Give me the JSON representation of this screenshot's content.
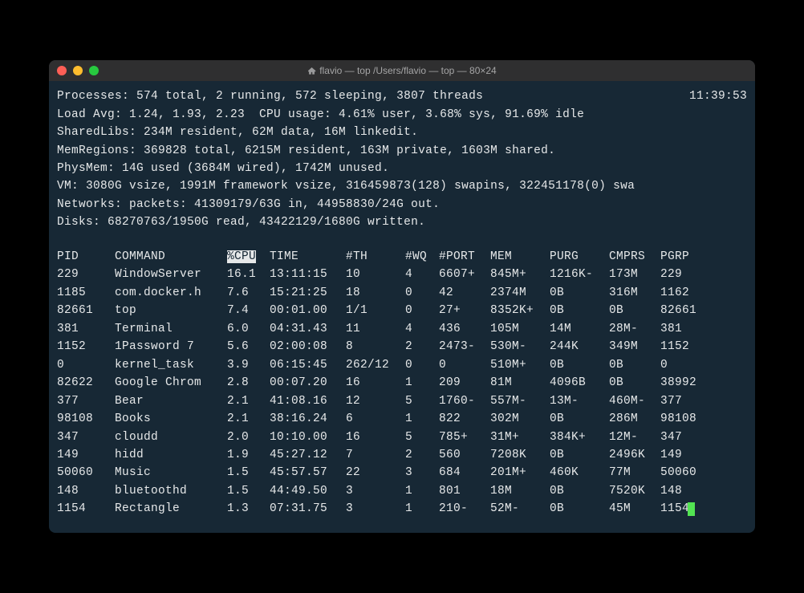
{
  "window": {
    "title": "flavio — top /Users/flavio — top — 80×24"
  },
  "summary": {
    "processes_line": "Processes: 574 total, 2 running, 572 sleeping, 3807 threads",
    "time": "11:39:53",
    "load_line": "Load Avg: 1.24, 1.93, 2.23  CPU usage: 4.61% user, 3.68% sys, 91.69% idle",
    "sharedlibs_line": "SharedLibs: 234M resident, 62M data, 16M linkedit.",
    "memregions_line": "MemRegions: 369828 total, 6215M resident, 163M private, 1603M shared.",
    "physmem_line": "PhysMem: 14G used (3684M wired), 1742M unused.",
    "vm_line": "VM: 3080G vsize, 1991M framework vsize, 316459873(128) swapins, 322451178(0) swa",
    "networks_line": "Networks: packets: 41309179/63G in, 44958830/24G out.",
    "disks_line": "Disks: 68270763/1950G read, 43422129/1680G written."
  },
  "headers": {
    "pid": "PID",
    "command": "COMMAND",
    "cpu": "%CPU",
    "time": "TIME",
    "th": "#TH",
    "wq": "#WQ",
    "port": "#PORT",
    "mem": "MEM",
    "purg": "PURG",
    "cmprs": "CMPRS",
    "pgrp": "PGRP"
  },
  "rows": [
    {
      "pid": "229",
      "command": "WindowServer",
      "cpu": "16.1",
      "time": "13:11:15",
      "th": "10",
      "wq": "4",
      "port": "6607+",
      "mem": "845M+",
      "purg": "1216K-",
      "cmprs": "173M",
      "pgrp": "229"
    },
    {
      "pid": "1185",
      "command": "com.docker.h",
      "cpu": "7.6",
      "time": "15:21:25",
      "th": "18",
      "wq": "0",
      "port": "42",
      "mem": "2374M",
      "purg": "0B",
      "cmprs": "316M",
      "pgrp": "1162"
    },
    {
      "pid": "82661",
      "command": "top",
      "cpu": "7.4",
      "time": "00:01.00",
      "th": "1/1",
      "wq": "0",
      "port": "27+",
      "mem": "8352K+",
      "purg": "0B",
      "cmprs": "0B",
      "pgrp": "82661"
    },
    {
      "pid": "381",
      "command": "Terminal",
      "cpu": "6.0",
      "time": "04:31.43",
      "th": "11",
      "wq": "4",
      "port": "436",
      "mem": "105M",
      "purg": "14M",
      "cmprs": "28M-",
      "pgrp": "381"
    },
    {
      "pid": "1152",
      "command": "1Password 7",
      "cpu": "5.6",
      "time": "02:00:08",
      "th": "8",
      "wq": "2",
      "port": "2473-",
      "mem": "530M-",
      "purg": "244K",
      "cmprs": "349M",
      "pgrp": "1152"
    },
    {
      "pid": "0",
      "command": "kernel_task",
      "cpu": "3.9",
      "time": "06:15:45",
      "th": "262/12",
      "wq": "0",
      "port": "0",
      "mem": "510M+",
      "purg": "0B",
      "cmprs": "0B",
      "pgrp": "0"
    },
    {
      "pid": "82622",
      "command": "Google Chrom",
      "cpu": "2.8",
      "time": "00:07.20",
      "th": "16",
      "wq": "1",
      "port": "209",
      "mem": "81M",
      "purg": "4096B",
      "cmprs": "0B",
      "pgrp": "38992"
    },
    {
      "pid": "377",
      "command": "Bear",
      "cpu": "2.1",
      "time": "41:08.16",
      "th": "12",
      "wq": "5",
      "port": "1760-",
      "mem": "557M-",
      "purg": "13M-",
      "cmprs": "460M-",
      "pgrp": "377"
    },
    {
      "pid": "98108",
      "command": "Books",
      "cpu": "2.1",
      "time": "38:16.24",
      "th": "6",
      "wq": "1",
      "port": "822",
      "mem": "302M",
      "purg": "0B",
      "cmprs": "286M",
      "pgrp": "98108"
    },
    {
      "pid": "347",
      "command": "cloudd",
      "cpu": "2.0",
      "time": "10:10.00",
      "th": "16",
      "wq": "5",
      "port": "785+",
      "mem": "31M+",
      "purg": "384K+",
      "cmprs": "12M-",
      "pgrp": "347"
    },
    {
      "pid": "149",
      "command": "hidd",
      "cpu": "1.9",
      "time": "45:27.12",
      "th": "7",
      "wq": "2",
      "port": "560",
      "mem": "7208K",
      "purg": "0B",
      "cmprs": "2496K",
      "pgrp": "149"
    },
    {
      "pid": "50060",
      "command": "Music",
      "cpu": "1.5",
      "time": "45:57.57",
      "th": "22",
      "wq": "3",
      "port": "684",
      "mem": "201M+",
      "purg": "460K",
      "cmprs": "77M",
      "pgrp": "50060"
    },
    {
      "pid": "148",
      "command": "bluetoothd",
      "cpu": "1.5",
      "time": "44:49.50",
      "th": "3",
      "wq": "1",
      "port": "801",
      "mem": "18M",
      "purg": "0B",
      "cmprs": "7520K",
      "pgrp": "148"
    },
    {
      "pid": "1154",
      "command": "Rectangle",
      "cpu": "1.3",
      "time": "07:31.75",
      "th": "3",
      "wq": "1",
      "port": "210-",
      "mem": "52M-",
      "purg": "0B",
      "cmprs": "45M",
      "pgrp": "1154"
    }
  ]
}
